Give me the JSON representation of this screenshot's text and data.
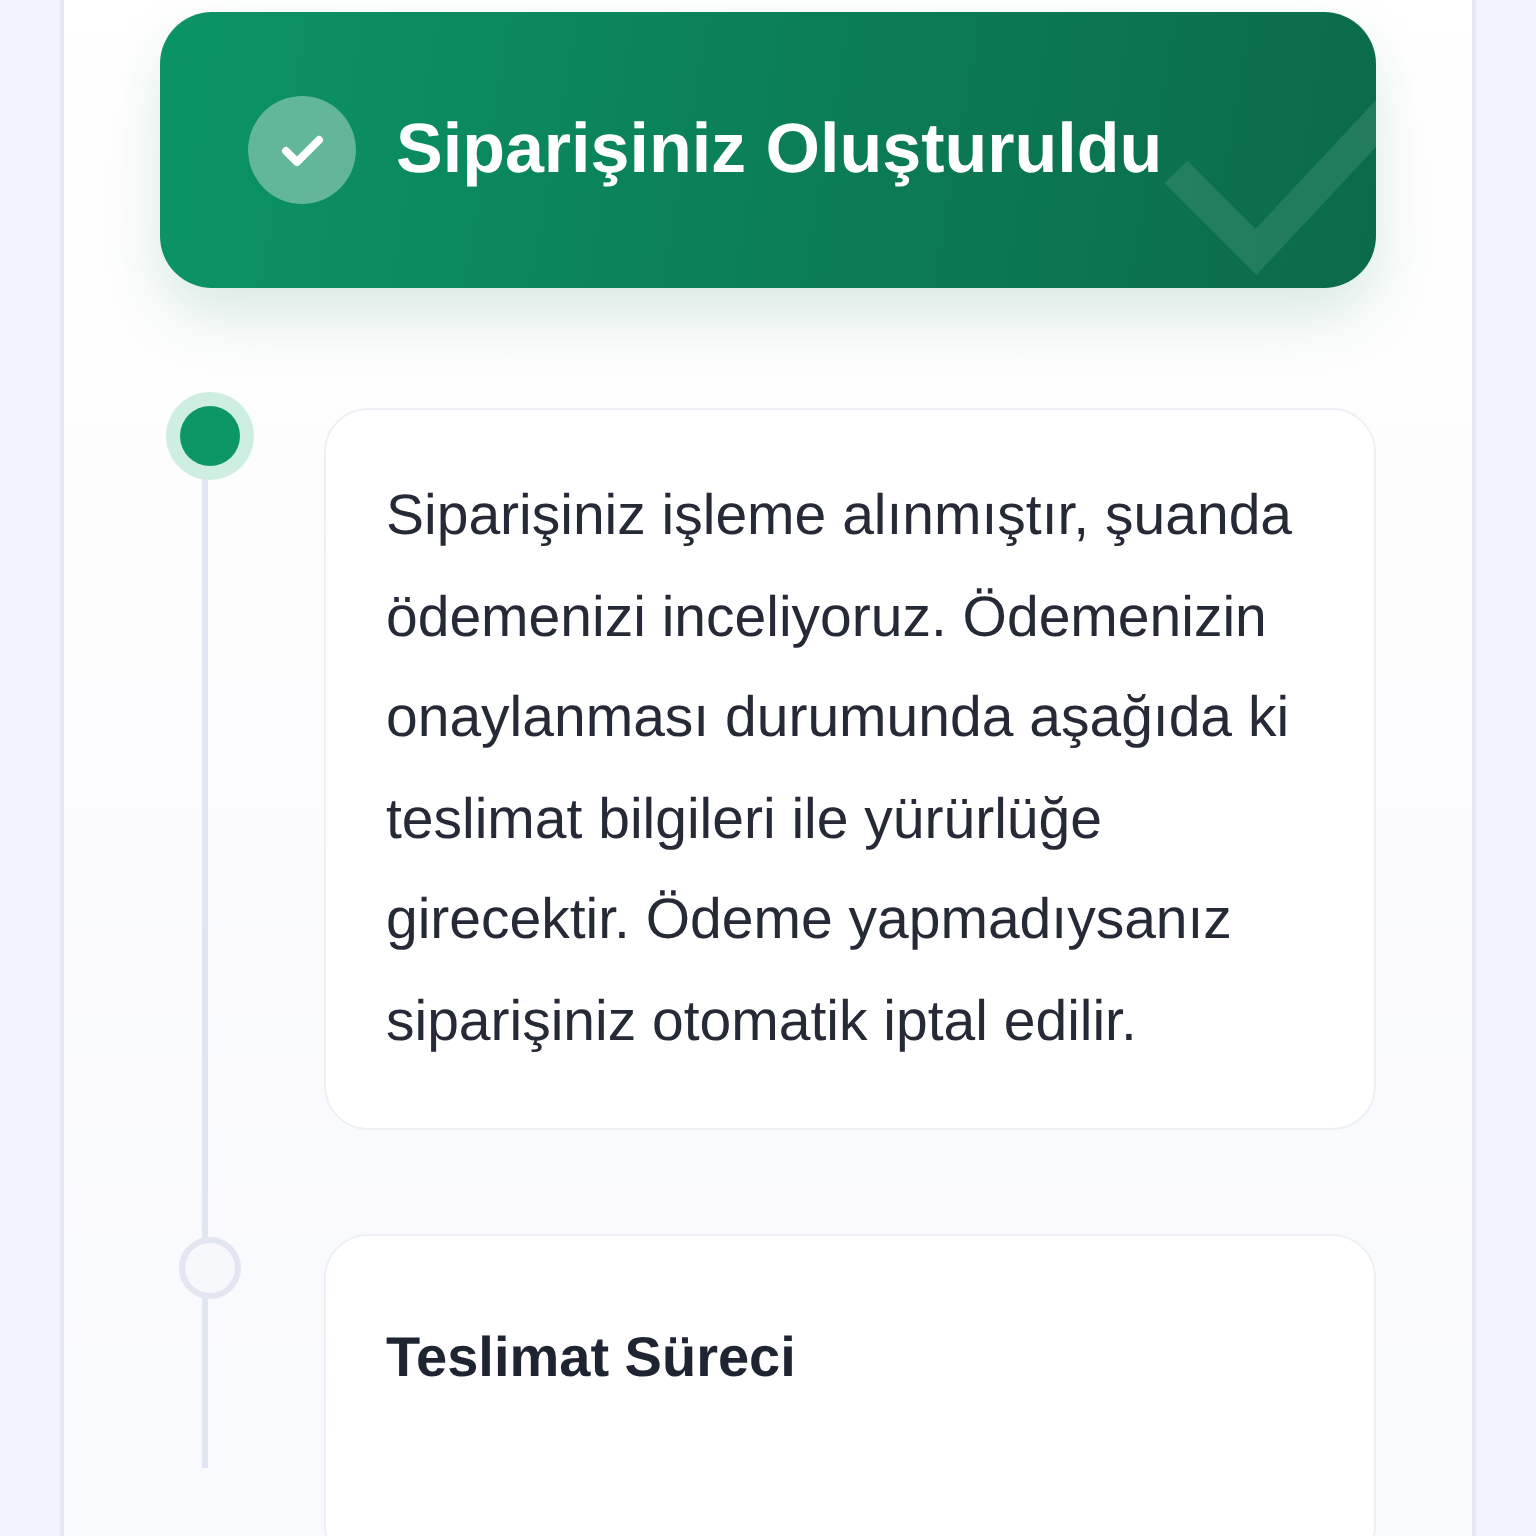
{
  "banner": {
    "title": "Siparişiniz Oluşturuldu"
  },
  "steps": [
    {
      "kind": "message",
      "active": true,
      "text": "Siparişiniz işleme alınmıştır, şuanda ödemenizi inceliyoruz. Ödemenizin onaylanması durumunda aşağıda ki teslimat bilgileri ile yürürlüğe girecektir. Ödeme yapmadıysanız siparişiniz otomatik iptal edilir."
    },
    {
      "kind": "section",
      "active": false,
      "title": "Teslimat Süreci"
    }
  ]
}
